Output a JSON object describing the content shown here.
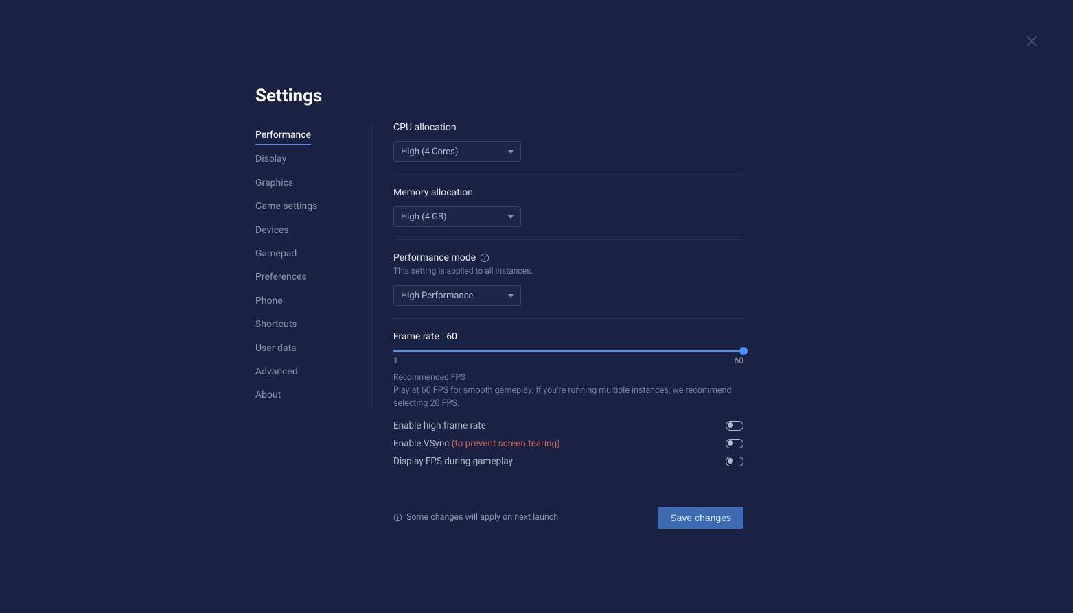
{
  "title": "Settings",
  "sidebar": {
    "items": [
      {
        "label": "Performance",
        "active": true
      },
      {
        "label": "Display"
      },
      {
        "label": "Graphics"
      },
      {
        "label": "Game settings"
      },
      {
        "label": "Devices"
      },
      {
        "label": "Gamepad"
      },
      {
        "label": "Preferences"
      },
      {
        "label": "Phone"
      },
      {
        "label": "Shortcuts"
      },
      {
        "label": "User data"
      },
      {
        "label": "Advanced"
      },
      {
        "label": "About"
      }
    ]
  },
  "cpu": {
    "label": "CPU allocation",
    "value": "High (4 Cores)"
  },
  "memory": {
    "label": "Memory allocation",
    "value": "High (4 GB)"
  },
  "perfmode": {
    "label": "Performance mode",
    "sublabel": "This setting is applied to all instances.",
    "value": "High Performance"
  },
  "framerate": {
    "label_prefix": "Frame rate : ",
    "value": "60",
    "min": "1",
    "max": "60",
    "rec_title": "Recommended FPS",
    "rec_text": "Play at 60 FPS for smooth gameplay. If you're running multiple instances, we recommend selecting 20 FPS."
  },
  "toggles": {
    "high_frame_rate": {
      "label": "Enable high frame rate",
      "on": false
    },
    "vsync": {
      "label_a": "Enable VSync ",
      "label_b": "(to prevent screen tearing)",
      "on": false
    },
    "display_fps": {
      "label": "Display FPS during gameplay",
      "on": false
    }
  },
  "footer": {
    "note": "Some changes will apply on next launch",
    "save": "Save changes"
  }
}
